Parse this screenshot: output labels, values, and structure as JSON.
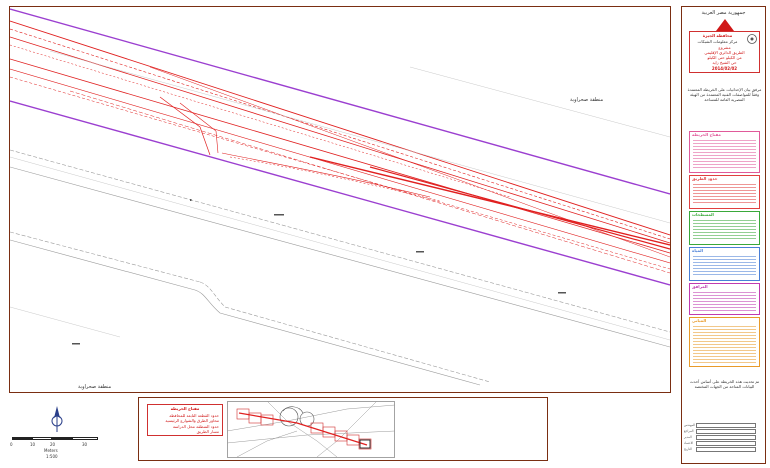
{
  "map": {
    "label_top": "منطقة صحراوية",
    "label_bottom": "منطقة صحراوية"
  },
  "title_block": {
    "header": "جمهورية مصر العربية",
    "authority": "محافظة الجيزة",
    "department": "مركز معلومات الشبكات",
    "project_lines": [
      "مشروع",
      "الطريق الدائري الإقليمي",
      "من الكيلو حتى الكيلو",
      "حي الشيخ زايد",
      "2014/02/02"
    ],
    "notes": "مرفق بيان الإحداثيات على الخريطة المعتمدة وفقاً للمواصفات الفنية المعتمدة من الهيئة المصرية العامة للمساحة",
    "footer_notes": "تم تحديث هذه الخريطة على أساس أحدث البيانات المتاحة من الجهات المختصة",
    "signatures": [
      "المهندس",
      "المراجع",
      "المدير",
      "الاعتماد",
      "التاريخ"
    ],
    "legend_groups": [
      {
        "name": "legend-pink",
        "title": "مفتاح الخريطة",
        "color": "#e05a9a"
      },
      {
        "name": "legend-red",
        "title": "حدود الطريق",
        "color": "#e04040"
      },
      {
        "name": "legend-green",
        "title": "المسطحات",
        "color": "#3aa83a"
      },
      {
        "name": "legend-blue",
        "title": "المياه",
        "color": "#4a7fd6"
      },
      {
        "name": "legend-magenta",
        "title": "المرافق",
        "color": "#c03ab0"
      },
      {
        "name": "legend-orange",
        "title": "المباني",
        "color": "#e89a2a"
      }
    ]
  },
  "overview": {
    "legend_title": "مفتاح الخريطة",
    "legend_lines": [
      "حدود القطعة التابعة للمحافظة",
      "محاور الطرق والشوارع الرئيسية",
      "حدود المنطقة محل الدراسة",
      "مسار الطريق"
    ]
  },
  "scale": {
    "ticks": [
      "0",
      "10",
      "20",
      "30"
    ],
    "unit": "Meters",
    "ratio": "1:500"
  },
  "colors": {
    "frame": "#7a2e12",
    "road_red": "#e02020",
    "boundary_purple": "#9b3fd0",
    "gray_line": "#9a9a9a"
  }
}
